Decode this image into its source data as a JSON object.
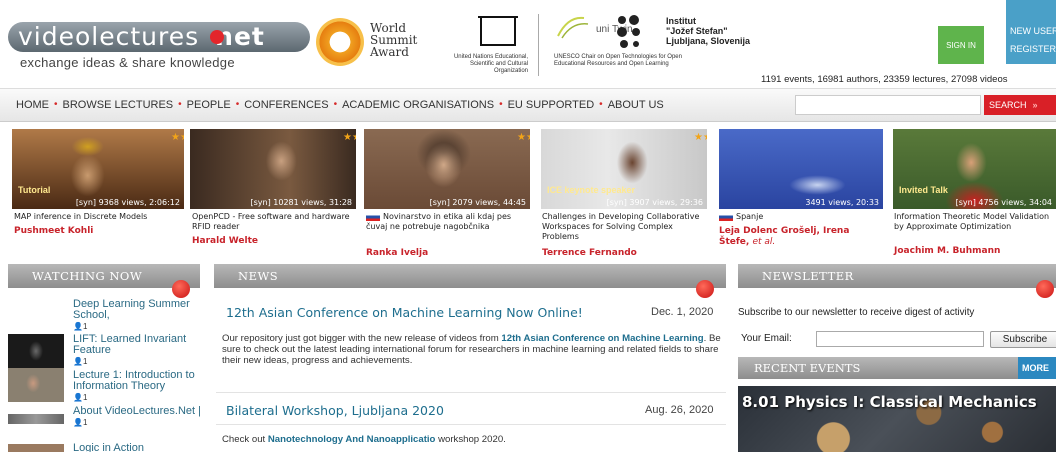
{
  "header": {
    "logo_text": "videolectures",
    "logo_net": "net",
    "tagline": "exchange ideas & share knowledge",
    "wsa": [
      "World",
      "Summit",
      "Award"
    ],
    "unesco_caption": "United Nations Educational, Scientific and Cultural Organization",
    "unitwin_text": "uni Twin",
    "unitwin_caption": "UNESCO Chair on Open Technologies for Open Educational Resources and Open Learning",
    "ijs_text": [
      "Institut",
      "\"Jožef Stefan\"",
      "Ljubljana, Slovenija"
    ],
    "signin_label": "SIGN IN",
    "newuser_label": "NEW USER",
    "register_label": "REGISTER",
    "stats": "1191 events, 16981 authors, 23359 lectures, 27098 videos"
  },
  "nav": {
    "items": [
      "HOME",
      "BROWSE LECTURES",
      "PEOPLE",
      "CONFERENCES",
      "ACADEMIC ORGANISATIONS",
      "EU SUPPORTED",
      "ABOUT US"
    ],
    "separator": "•",
    "search_label": "SEARCH",
    "search_arrow": "»"
  },
  "videos": [
    {
      "badge": "Tutorial",
      "meta": "[syn]  9368 views, 2:06:12",
      "title": "MAP inference in Discrete Models",
      "author": "Pushmeet Kohli",
      "stars": "★★★★"
    },
    {
      "badge": "",
      "meta": "[syn]  10281 views, 31:28",
      "title": "OpenPCD - Free software and hardware RFID reader",
      "author": "Harald Welte",
      "stars": "★★★★★"
    },
    {
      "badge": "",
      "meta": "[syn]  2079 views, 44:45",
      "title": "Novinarstvo in etika ali kdaj pes čuvaj ne potrebuje nagobčnika",
      "author": "Ranka Ivelja",
      "stars": "★★★★★"
    },
    {
      "badge": "ICE keynote speaker",
      "meta": "[syn]  3907 views, 29:36",
      "title": "Challenges in Developing Collaborative Workspaces for Solving Complex Problems",
      "author": "Terrence Fernando",
      "stars": "★★★"
    },
    {
      "badge": "",
      "meta": "3491 views, 20:33",
      "title": "Spanje",
      "author": "Leja Dolenc Grošelj, Irena Štefe,",
      "author_suffix": "et al.",
      "stars": ""
    },
    {
      "badge": "Invited Talk",
      "meta": "[syn]  4756 views, 34:04",
      "title": "Information Theoretic Model Validation by Approximate Optimization",
      "author": "Joachim M. Buhmann",
      "stars": ""
    }
  ],
  "watching": {
    "heading": "WATCHING NOW",
    "items": [
      {
        "title": "Deep Learning Summer School,",
        "count": "1"
      },
      {
        "title": "LIFT: Learned Invariant Feature",
        "count": "1"
      },
      {
        "title": "Lecture 1: Introduction to Information Theory",
        "count": "1"
      },
      {
        "title": "About VideoLectures.Net |",
        "count": "1"
      },
      {
        "title": "Logic in Action",
        "count": ""
      }
    ]
  },
  "news": {
    "heading": "NEWS",
    "items": [
      {
        "title": "12th Asian Conference on Machine Learning Now Online!",
        "date": "Dec. 1, 2020",
        "body_pre": "Our repository just got bigger with the new release of videos from ",
        "body_link": "12th Asian Conference on Machine Learning",
        "body_post": ". Be sure to check out the latest leading international forum for researchers in machine learning and related fields to share their new ideas, progress and achievements."
      },
      {
        "title": "Bilateral Workshop, Ljubljana 2020",
        "date": "Aug. 26, 2020",
        "body_pre": "Check out ",
        "body_link": "Nanotechnology And Nanoapplicatio",
        "body_post": " workshop 2020."
      }
    ]
  },
  "newsletter": {
    "heading": "NEWSLETTER",
    "description": "Subscribe to our newsletter to receive digest of activity",
    "email_label": "Your Email:",
    "email_value": "",
    "subscribe_label": "Subscribe"
  },
  "recent_events": {
    "heading": "RECENT EVENTS",
    "more_label": "MORE",
    "event_title": "8.01 Physics I: Classical Mechanics"
  },
  "colors": {
    "brand_red": "#d92027",
    "link_blue": "#1e6e8e",
    "author_red": "#c8232b",
    "signin_green": "#5fb44c",
    "register_blue": "#4aa0c8",
    "more_blue": "#2b88c0"
  }
}
